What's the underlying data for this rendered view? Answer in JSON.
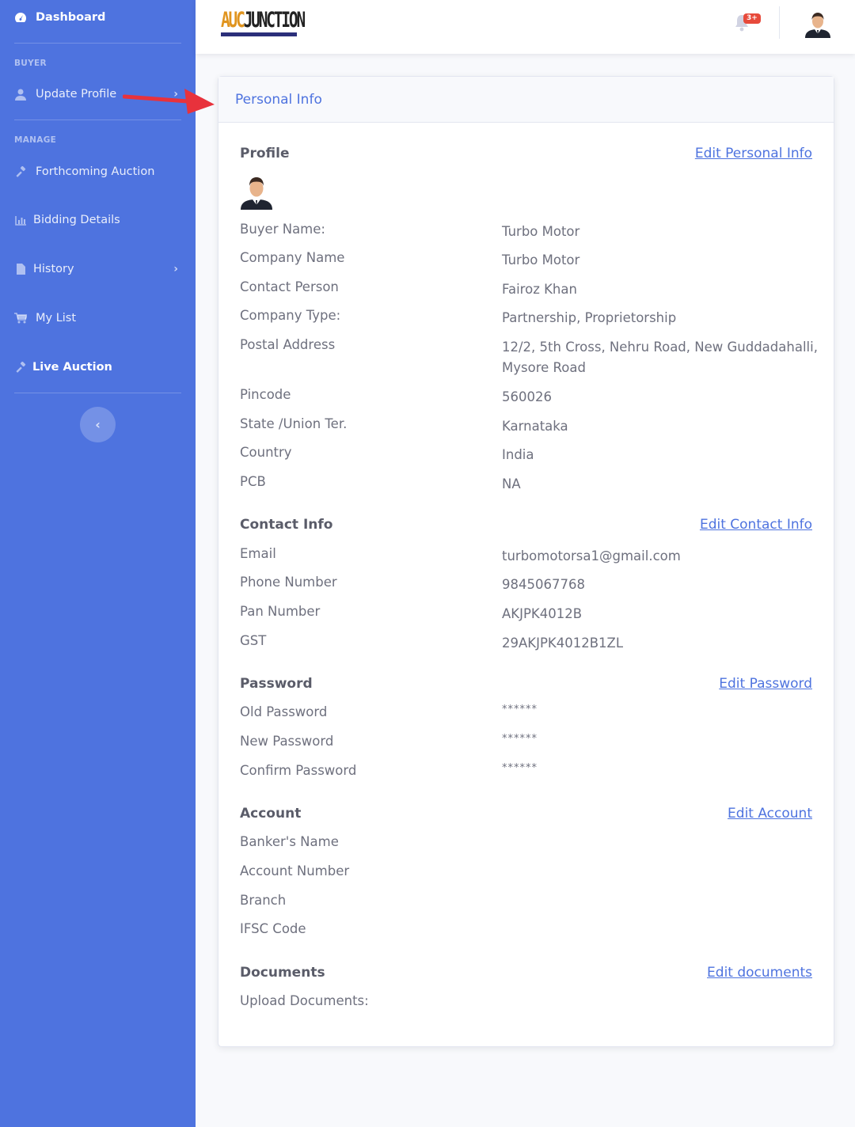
{
  "sidebar": {
    "dashboard": "Dashboard",
    "heading_buyer": "BUYER",
    "update_profile": "Update Profile",
    "heading_manage": "MANAGE",
    "forthcoming_auction": "Forthcoming Auction",
    "bidding_details": "Bidding Details",
    "history": "History",
    "my_list": "My List",
    "live_auction": "Live Auction",
    "toggle_icon": "chevron-left-icon"
  },
  "topbar": {
    "logo_part1": "AUC",
    "logo_part2": "JUNCTION",
    "notification_badge": "3+"
  },
  "card": {
    "title": "Personal Info",
    "profile": {
      "section_title": "Profile",
      "edit_label": "Edit Personal Info",
      "fields": [
        {
          "label": "Buyer Name:",
          "value": "Turbo Motor"
        },
        {
          "label": "Company Name",
          "value": "Turbo Motor"
        },
        {
          "label": "Contact Person",
          "value": "Fairoz Khan"
        },
        {
          "label": "Company Type:",
          "value": "Partnership, Proprietorship"
        },
        {
          "label": "Postal Address",
          "value": "12/2, 5th Cross, Nehru Road, New Guddadahalli, Mysore Road"
        },
        {
          "label": "Pincode",
          "value": "560026"
        },
        {
          "label": "State /Union Ter.",
          "value": "Karnataka"
        },
        {
          "label": "Country",
          "value": "India"
        },
        {
          "label": "PCB",
          "value": "NA"
        }
      ]
    },
    "contact": {
      "section_title": "Contact Info",
      "edit_label": "Edit Contact Info",
      "fields": [
        {
          "label": "Email",
          "value": "turbomotorsa1@gmail.com"
        },
        {
          "label": "Phone Number",
          "value": "9845067768"
        },
        {
          "label": "Pan Number",
          "value": "AKJPK4012B"
        },
        {
          "label": "GST",
          "value": "29AKJPK4012B1ZL"
        }
      ]
    },
    "password": {
      "section_title": "Password",
      "edit_label": "Edit Password",
      "fields": [
        {
          "label": "Old Password",
          "value": "******"
        },
        {
          "label": "New Password",
          "value": "******"
        },
        {
          "label": "Confirm Password",
          "value": "******"
        }
      ]
    },
    "account": {
      "section_title": "Account",
      "edit_label": "Edit Account",
      "fields": [
        {
          "label": "Banker's Name"
        },
        {
          "label": "Account Number"
        },
        {
          "label": "Branch"
        },
        {
          "label": "IFSC Code"
        }
      ]
    },
    "documents": {
      "section_title": "Documents",
      "edit_label": "Edit documents",
      "fields": [
        {
          "label": "Upload Documents:"
        }
      ]
    }
  },
  "colors": {
    "sidebar": "#4e73df",
    "accent": "#4e73df",
    "badge": "#e74a3b",
    "arrow": "#e8323c"
  }
}
